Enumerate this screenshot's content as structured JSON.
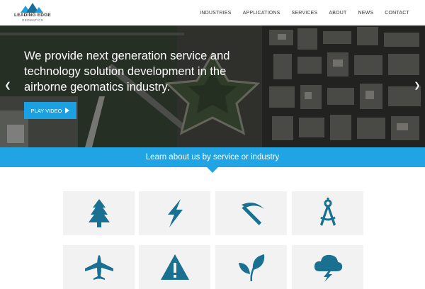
{
  "header": {
    "logo": {
      "name": "LEADING EDGE",
      "subtitle": "GEOMATICS"
    },
    "nav": [
      "INDUSTRIES",
      "APPLICATIONS",
      "SERVICES",
      "ABOUT",
      "NEWS",
      "CONTACT"
    ]
  },
  "hero": {
    "headline": "We provide next generation service and technology solution development in the airborne geomatics industry.",
    "play_button": "PLAY VIDEO",
    "prev_icon": "chevron-left-icon",
    "next_icon": "chevron-right-icon"
  },
  "band": {
    "text": "Learn about us by service or industry"
  },
  "tiles": [
    {
      "icon": "tree-icon"
    },
    {
      "icon": "lightning-icon"
    },
    {
      "icon": "pickaxe-icon"
    },
    {
      "icon": "compass-icon"
    },
    {
      "icon": "airplane-icon"
    },
    {
      "icon": "warning-icon"
    },
    {
      "icon": "leaf-icon"
    },
    {
      "icon": "storm-cloud-icon"
    }
  ],
  "colors": {
    "accent": "#20a4e4",
    "icon": "#1a7091",
    "tile": "#f2f2f2"
  }
}
